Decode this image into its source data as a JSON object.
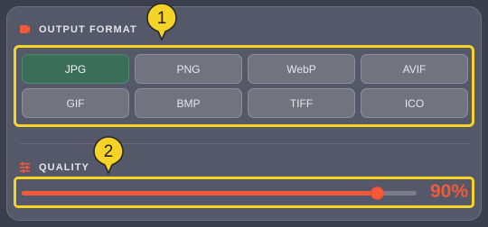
{
  "output_format": {
    "label": "OUTPUT FORMAT",
    "options": [
      "JPG",
      "PNG",
      "WebP",
      "AVIF",
      "GIF",
      "BMP",
      "TIFF",
      "ICO"
    ],
    "selected": "JPG"
  },
  "quality": {
    "label": "QUALITY",
    "value": 90,
    "value_text": "90%"
  },
  "callouts": {
    "first": "1",
    "second": "2"
  },
  "colors": {
    "accent": "#f05a3a",
    "selected_bg": "#3b6e58",
    "highlight": "#f5d327"
  },
  "icons": {
    "output_format": "image-icon",
    "quality": "sliders-icon"
  }
}
